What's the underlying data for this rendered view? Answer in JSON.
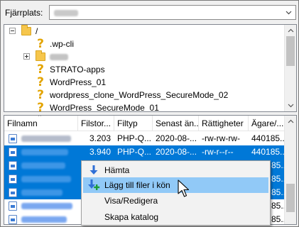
{
  "address": {
    "label": "Fjärrplats:",
    "value_redacted": true
  },
  "tree": {
    "items": [
      {
        "label": "/",
        "icon": "folder-icon"
      },
      {
        "label": ".wp-cli",
        "icon": "unknown-question-icon"
      },
      {
        "label": "",
        "icon": "folder-icon",
        "redacted": true
      },
      {
        "label": "STRATO-apps",
        "icon": "unknown-question-icon"
      },
      {
        "label": "WordPress_01",
        "icon": "unknown-question-icon"
      },
      {
        "label": "wordpress_clone_WordPress_SecureMode_02",
        "icon": "unknown-question-icon"
      },
      {
        "label": "WordPress_SecureMode_01",
        "icon": "unknown-question-icon"
      }
    ]
  },
  "list": {
    "columns": [
      "Filnamn",
      "Filstor...",
      "Filtyp",
      "Senast än...",
      "Rättigheter",
      "Ägare/..."
    ],
    "rows": [
      {
        "size": "3.203",
        "type": "PHP-Q...",
        "date": "2020-08-...",
        "perms": "-rw-rw-rw-",
        "owner": "440185...",
        "selected": false
      },
      {
        "size": "3.940",
        "type": "PHP-Q...",
        "date": "2020-08-...",
        "perms": "-rw-r--r--",
        "owner": "440185...",
        "selected": true
      },
      {
        "size": "",
        "type": "",
        "date": "",
        "perms": "",
        "owner": "85...",
        "selected": true
      },
      {
        "size": "",
        "type": "",
        "date": "",
        "perms": "",
        "owner": "85...",
        "selected": true
      },
      {
        "size": "",
        "type": "",
        "date": "",
        "perms": "",
        "owner": "85...",
        "selected": true
      },
      {
        "size": "",
        "type": "",
        "date": "",
        "perms": "",
        "owner": "85...",
        "selected": false
      },
      {
        "size": "",
        "type": "",
        "date": "",
        "perms": "",
        "owner": "85...",
        "selected": false
      }
    ]
  },
  "context_menu": {
    "items": [
      {
        "label": "Hämta",
        "icon": "download-arrow-icon"
      },
      {
        "label": "Lägg till filer i kön",
        "icon": "add-to-queue-icon",
        "hover": true
      },
      {
        "label": "Visa/Redigera",
        "icon": ""
      },
      {
        "label": "Skapa katalog",
        "icon": ""
      }
    ]
  },
  "colors": {
    "selection": "#0078d7",
    "menu_hover": "#91c9f7",
    "question": "#e3a400"
  }
}
